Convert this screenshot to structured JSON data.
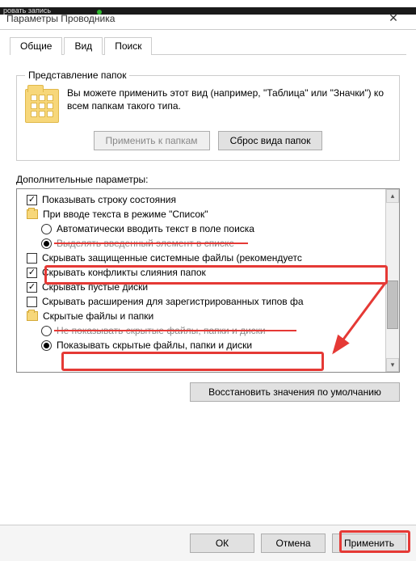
{
  "window": {
    "title": "Параметры Проводника"
  },
  "tabs": {
    "general": "Общие",
    "view": "Вид",
    "search": "Поиск"
  },
  "folderview": {
    "legend": "Представление папок",
    "desc": "Вы можете применить этот вид (например, \"Таблица\" или \"Значки\") ко всем папкам такого типа.",
    "apply": "Применить к папкам",
    "reset": "Сброс вида папок"
  },
  "advanced": {
    "label": "Дополнительные параметры:",
    "items": [
      {
        "type": "chk",
        "checked": true,
        "indent": 1,
        "text": "Показывать строку состояния"
      },
      {
        "type": "folder",
        "indent": 1,
        "text": "При вводе текста в режиме \"Список\""
      },
      {
        "type": "radio",
        "checked": false,
        "indent": 2,
        "text": "Автоматически вводить текст в поле поиска"
      },
      {
        "type": "radio",
        "checked": true,
        "indent": 2,
        "text": "Выделять введенный элемент в списке",
        "struck": true
      },
      {
        "type": "chk",
        "checked": false,
        "indent": 1,
        "text": "Скрывать защищенные системные файлы (рекомендуетс"
      },
      {
        "type": "chk",
        "checked": true,
        "indent": 1,
        "text": "Скрывать конфликты слияния папок"
      },
      {
        "type": "chk",
        "checked": true,
        "indent": 1,
        "text": "Скрывать пустые диски"
      },
      {
        "type": "chk",
        "checked": false,
        "indent": 1,
        "text": "Скрывать расширения для зарегистрированных типов фа"
      },
      {
        "type": "folder",
        "indent": 1,
        "text": "Скрытые файлы и папки"
      },
      {
        "type": "radio",
        "checked": false,
        "indent": 2,
        "text": "Не показывать скрытые файлы, папки и диски",
        "struck": true
      },
      {
        "type": "radio",
        "checked": true,
        "indent": 2,
        "text": "Показывать скрытые файлы, папки и диски"
      }
    ],
    "restore": "Восстановить значения по умолчанию"
  },
  "buttons": {
    "ok": "ОК",
    "cancel": "Отмена",
    "apply": "Применить"
  }
}
